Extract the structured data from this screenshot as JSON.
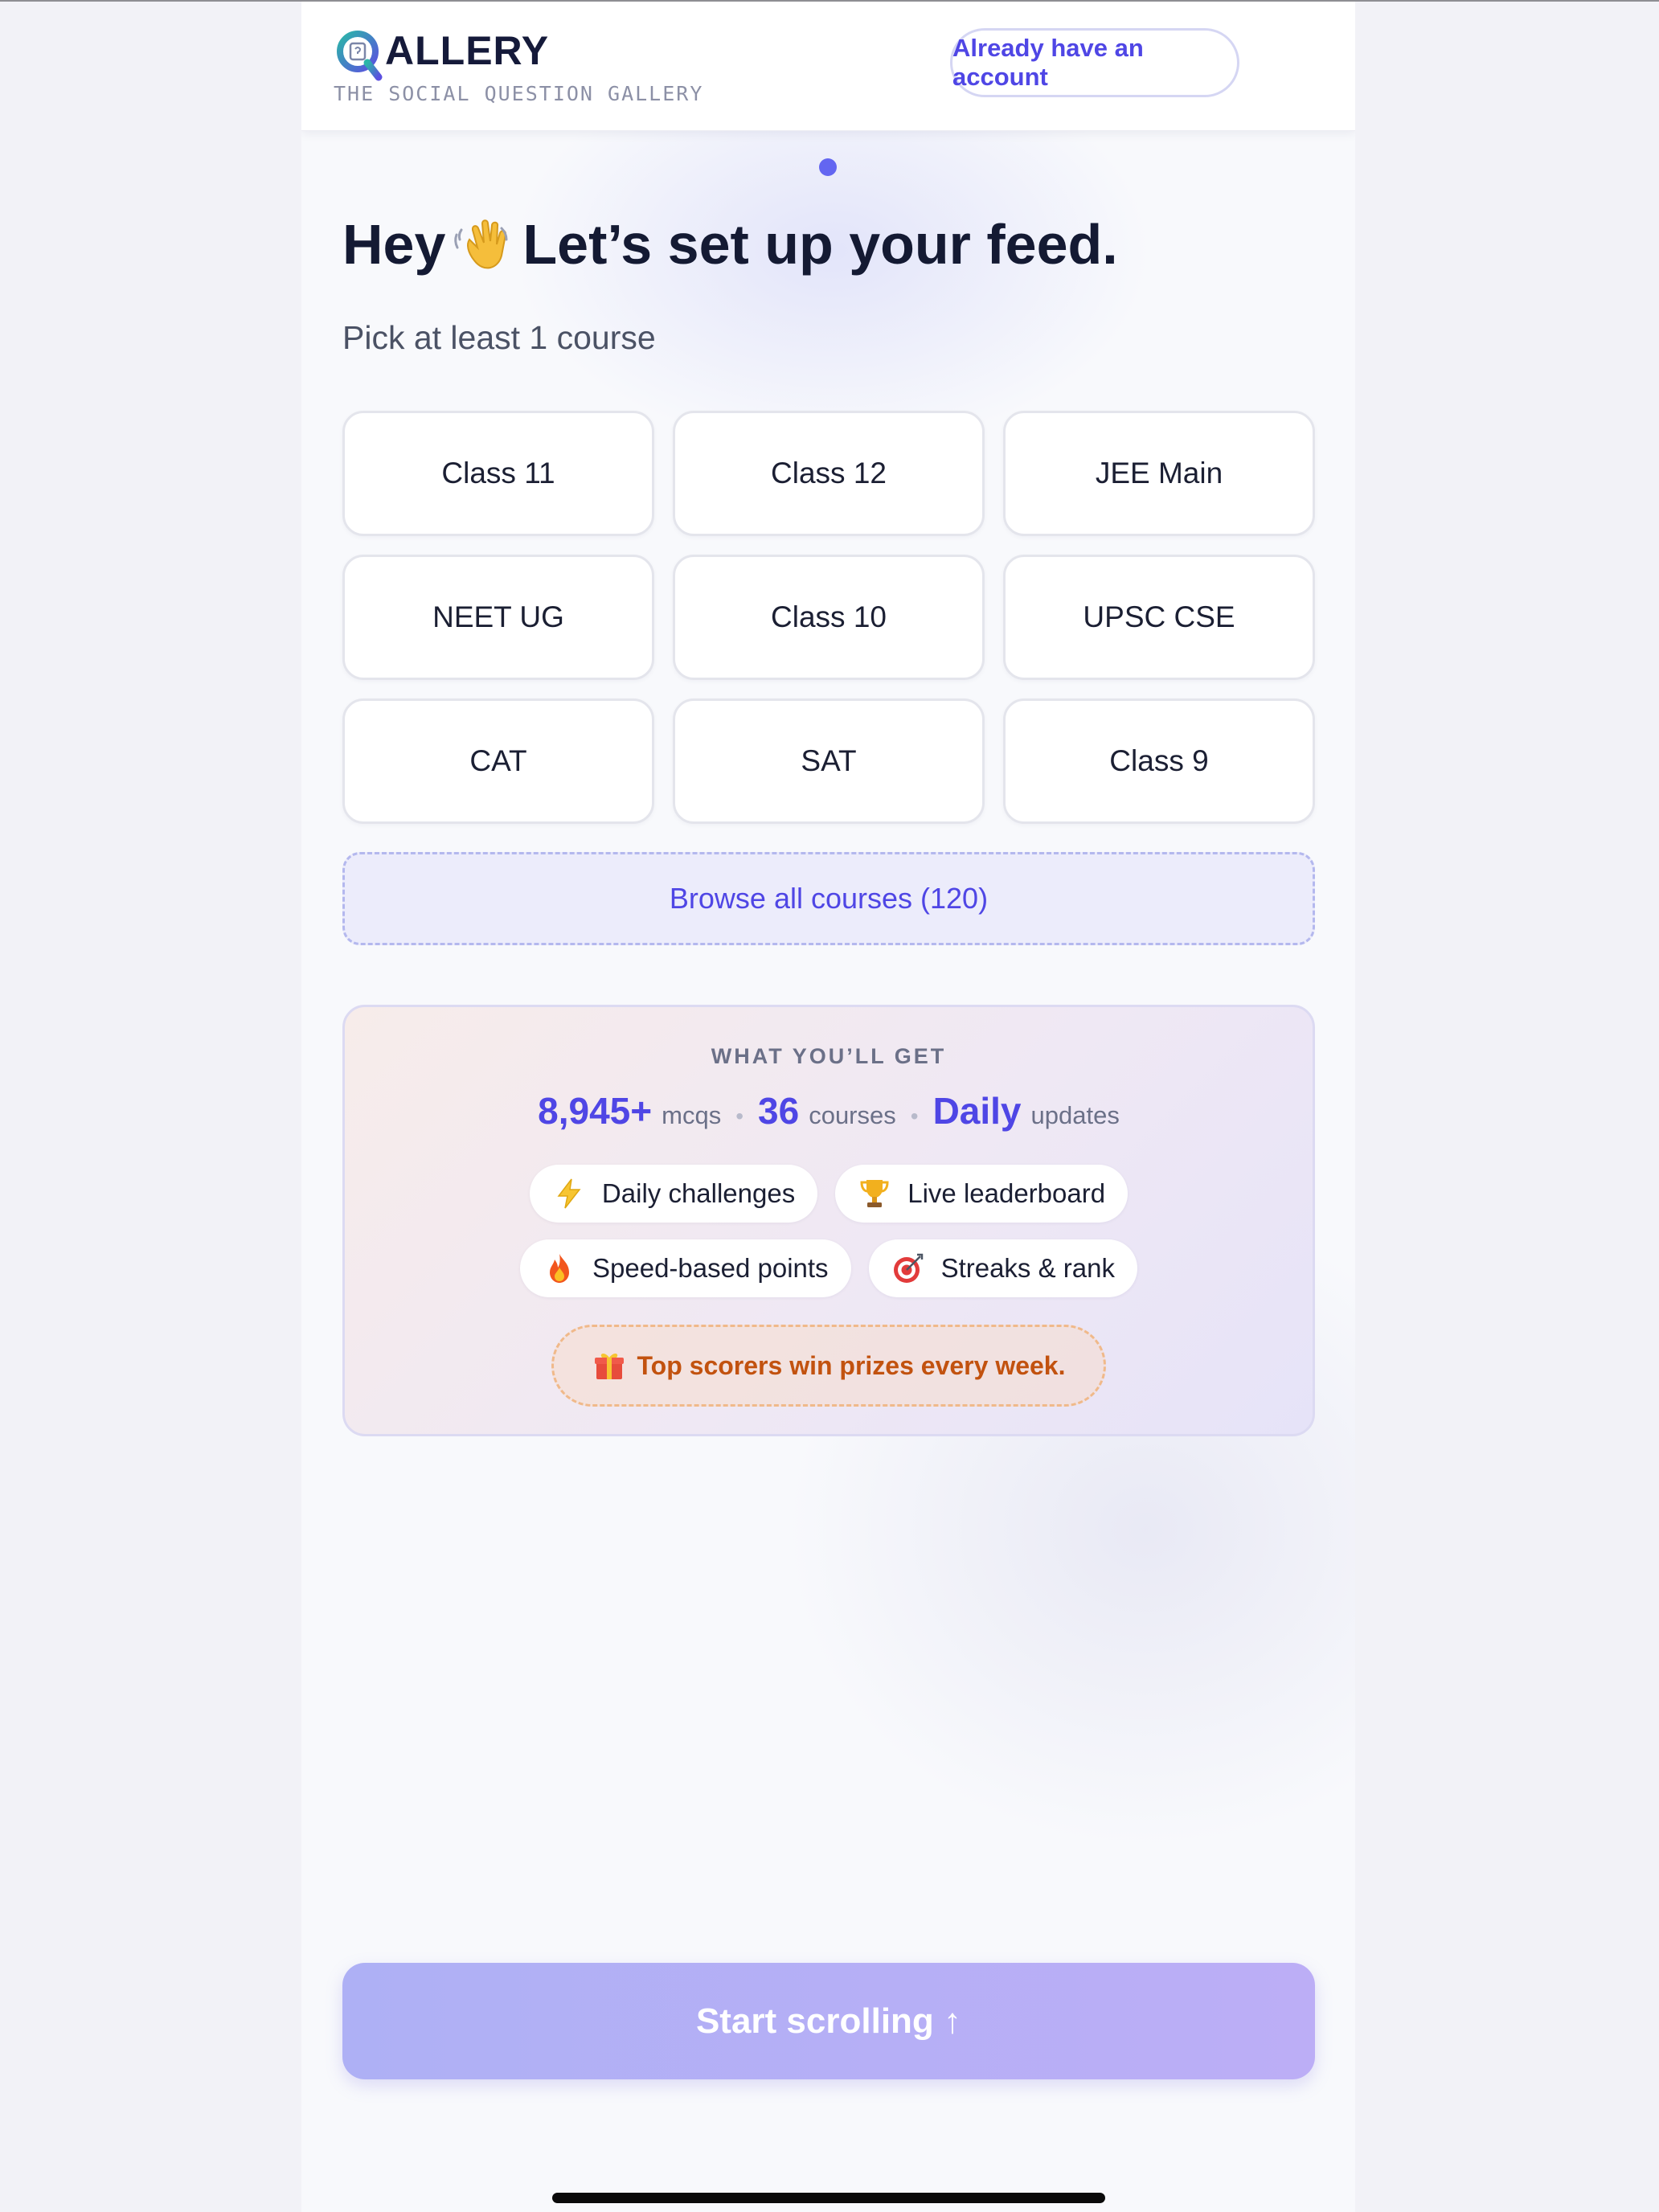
{
  "header": {
    "logo_text": "ALLERY",
    "tagline": "THE SOCIAL QUESTION GALLERY",
    "login_button": "Already have an account"
  },
  "onboarding": {
    "headline_start": "Hey",
    "headline_end": "Let’s set up your feed.",
    "subtitle": "Pick at least 1 course",
    "courses": [
      {
        "label": "Class 11"
      },
      {
        "label": "Class 12"
      },
      {
        "label": "JEE Main"
      },
      {
        "label": "NEET UG"
      },
      {
        "label": "Class 10"
      },
      {
        "label": "UPSC CSE"
      },
      {
        "label": "CAT"
      },
      {
        "label": "SAT"
      },
      {
        "label": "Class 9"
      }
    ],
    "browse_button": "Browse all courses (120)"
  },
  "perks": {
    "title": "WHAT YOU’LL GET",
    "stats": [
      {
        "value": "8,945+",
        "label": "mcqs"
      },
      {
        "value": "36",
        "label": "courses"
      },
      {
        "value": "Daily",
        "label": "updates"
      }
    ],
    "separator": "•",
    "chips": [
      {
        "icon": "lightning-icon",
        "label": "Daily challenges"
      },
      {
        "icon": "trophy-icon",
        "label": "Live leaderboard"
      },
      {
        "icon": "fire-icon",
        "label": "Speed-based points"
      },
      {
        "icon": "target-icon",
        "label": "Streaks & rank"
      }
    ],
    "prize": {
      "icon": "gift-icon",
      "text": "Top scorers win prizes every week."
    }
  },
  "footer": {
    "start_button": "Start scrolling ↑"
  },
  "colors": {
    "accent": "#4f46e5",
    "indicator": "#6366f1",
    "prize_text": "#c2520f",
    "start_gradient_from": "#aeb0f5",
    "start_gradient_to": "#bcaef6"
  }
}
